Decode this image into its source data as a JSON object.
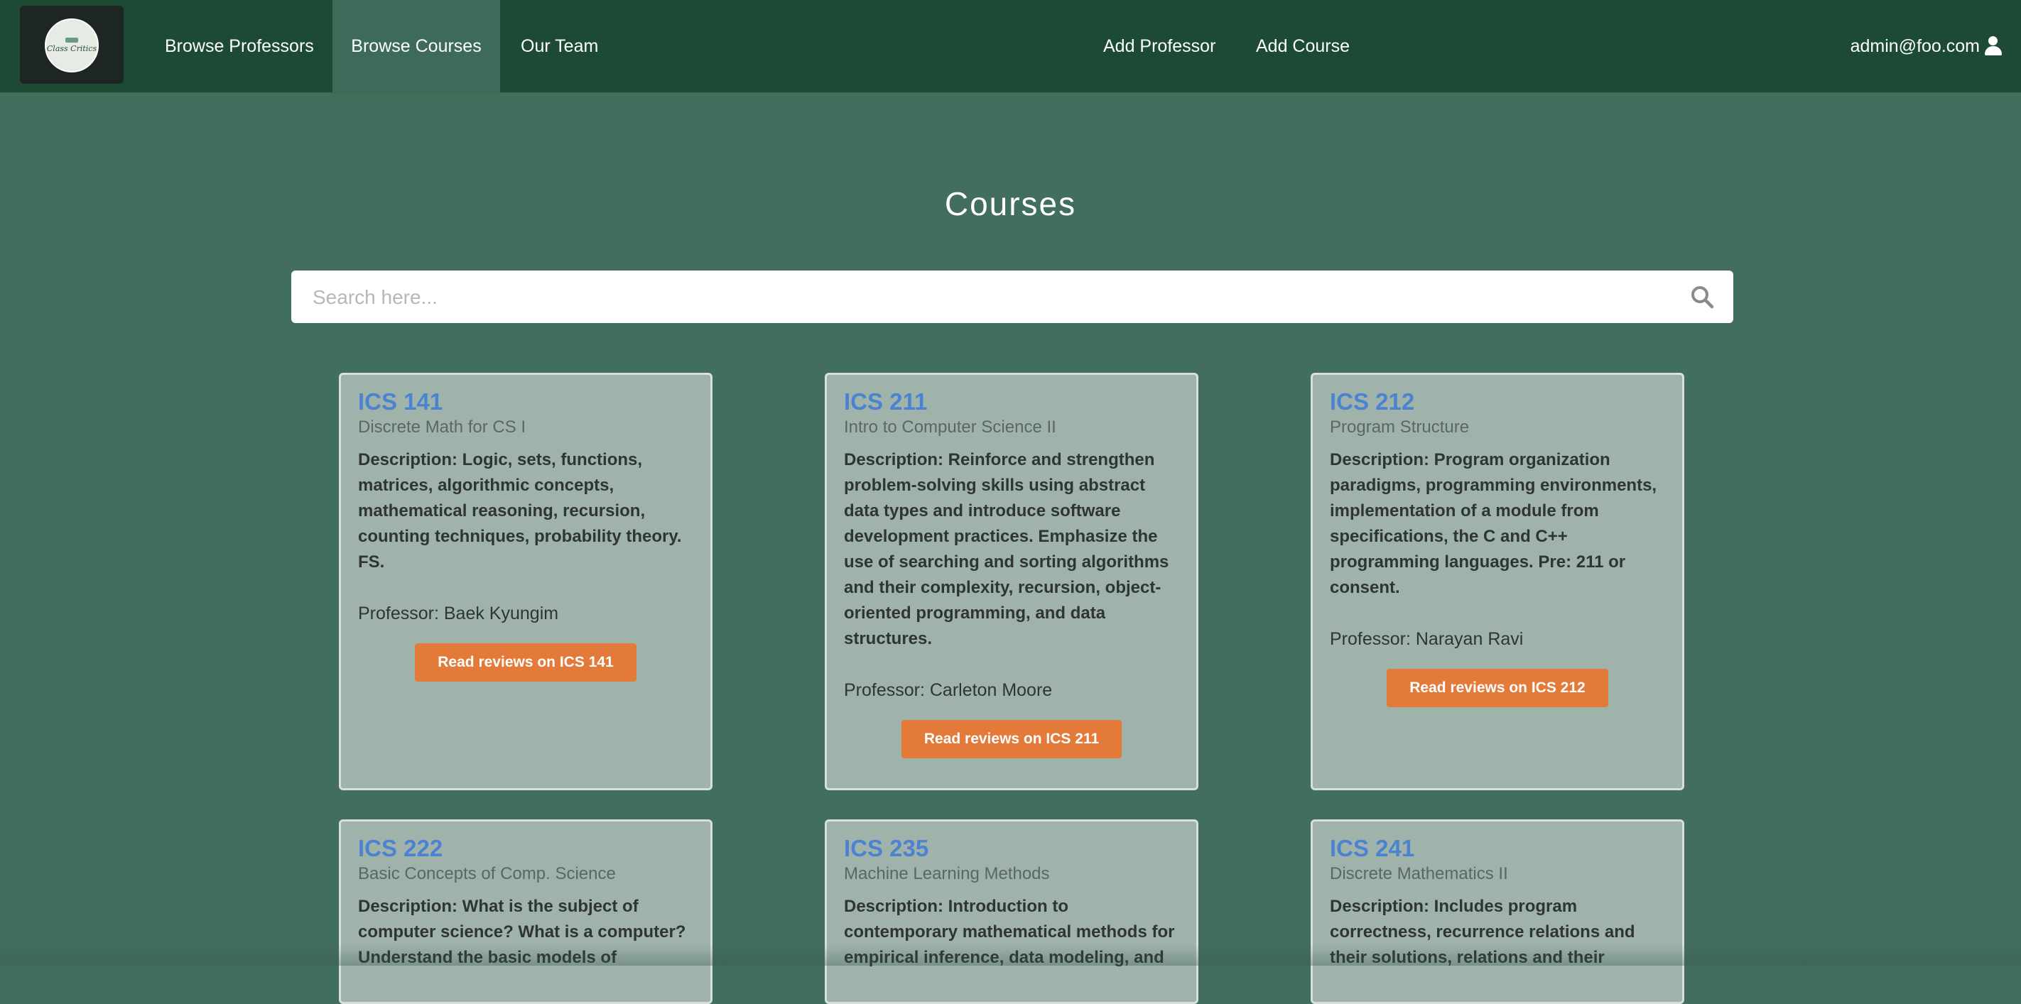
{
  "logo": {
    "text": "Class Critics",
    "alt": "Class Critics logo"
  },
  "nav": {
    "browse_professors": "Browse Professors",
    "browse_courses": "Browse Courses",
    "our_team": "Our Team",
    "add_professor": "Add Professor",
    "add_course": "Add Course",
    "user_email": "admin@foo.com"
  },
  "page": {
    "title": "Courses"
  },
  "search": {
    "placeholder": "Search here...",
    "value": ""
  },
  "courses": [
    {
      "code": "ICS 141",
      "name": "Discrete Math for CS I",
      "description": "Description: Logic, sets, functions, matrices, algorithmic concepts, mathematical reasoning, recursion, counting techniques, probability theory. FS.",
      "professor": "Professor: Baek Kyungim",
      "button": "Read reviews on ICS 141"
    },
    {
      "code": "ICS 211",
      "name": "Intro to Computer Science II",
      "description": "Description: Reinforce and strengthen problem-solving skills using abstract data types and introduce software development practices. Emphasize the use of searching and sorting algorithms and their complexity, recursion, object-oriented programming, and data structures.",
      "professor": "Professor: Carleton Moore",
      "button": "Read reviews on ICS 211"
    },
    {
      "code": "ICS 212",
      "name": "Program Structure",
      "description": "Description: Program organization paradigms, programming environments, implementation of a module from specifications, the C and C++ programming languages. Pre: 211 or consent.",
      "professor": "Professor: Narayan Ravi",
      "button": "Read reviews on ICS 212"
    },
    {
      "code": "ICS 222",
      "name": "Basic Concepts of Comp. Science",
      "description": "Description: What is the subject of computer science? What is a computer? Understand the basic models of"
    },
    {
      "code": "ICS 235",
      "name": "Machine Learning Methods",
      "description": "Description: Introduction to contemporary mathematical methods for empirical inference, data modeling, and"
    },
    {
      "code": "ICS 241",
      "name": "Discrete Mathematics II",
      "description": "Description: Includes program correctness, recurrence relations and their solutions, relations and their"
    }
  ],
  "colors": {
    "navbar": "#1c4a35",
    "background": "#426e5d",
    "card": "#9fb3ab",
    "course_code": "#4b83d0",
    "button": "#e37a39"
  }
}
